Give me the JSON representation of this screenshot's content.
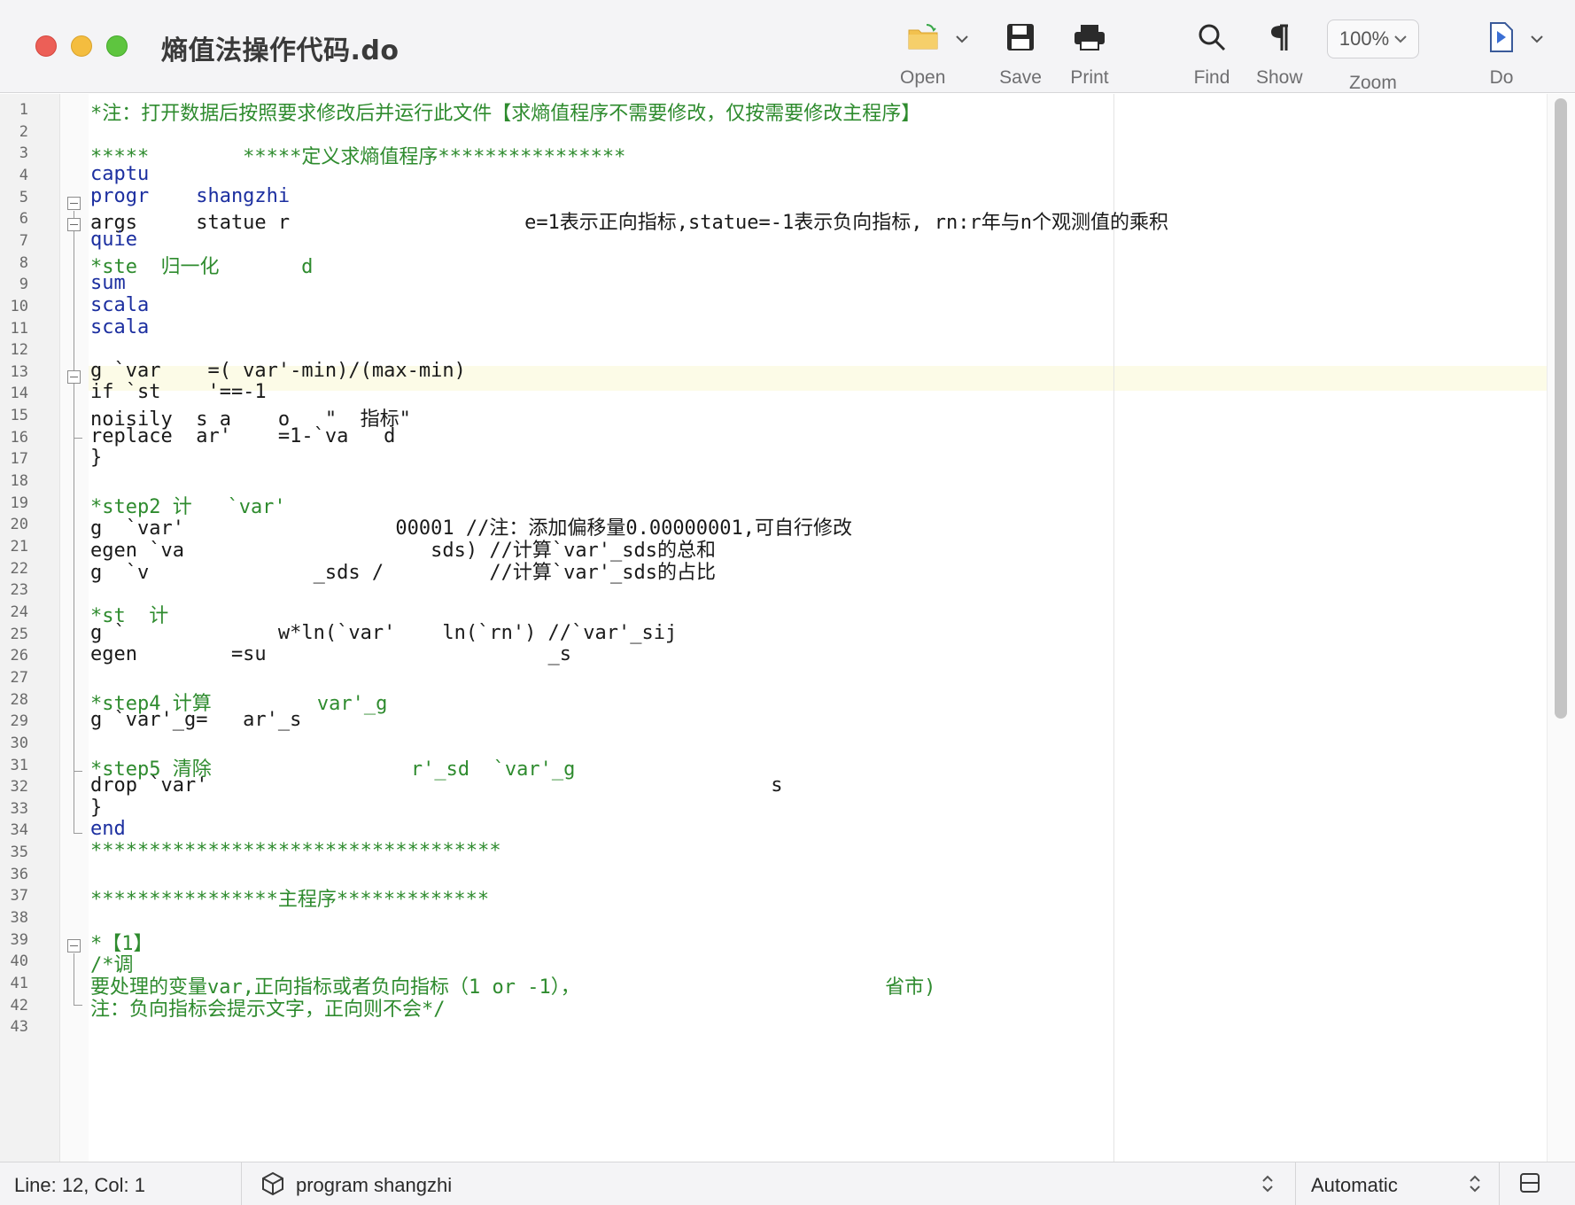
{
  "window": {
    "title": "熵值法操作代码.do"
  },
  "toolbar": {
    "open_label": "Open",
    "save_label": "Save",
    "print_label": "Print",
    "find_label": "Find",
    "show_label": "Show",
    "zoom_label": "Zoom",
    "zoom_value": "100%",
    "do_label": "Do"
  },
  "editor": {
    "current_line": 12,
    "line_numbers": [
      "1",
      "2",
      "3",
      "4",
      "5",
      "6",
      "7",
      "8",
      "9",
      "10",
      "11",
      "12",
      "13",
      "14",
      "15",
      "16",
      "17",
      "18",
      "19",
      "20",
      "21",
      "22",
      "23",
      "24",
      "25",
      "26",
      "27",
      "28",
      "29",
      "30",
      "31",
      "32",
      "33",
      "34",
      "35",
      "36",
      "37",
      "38",
      "39",
      "40",
      "41",
      "42",
      "43"
    ],
    "lines": [
      {
        "n": 1,
        "text": "*注：打开数据后按照要求修改后并运行此文件【求熵值程序不需要修改，仅按需要修改主程序】",
        "kind": "comment"
      },
      {
        "n": 3,
        "text": "*****        *****定义求熵值程序****************",
        "kind": "comment"
      },
      {
        "n": 4,
        "text": "captu",
        "kind": "kw"
      },
      {
        "n": 5,
        "text": "progr    shangzhi",
        "kind": "kw"
      },
      {
        "n": 6,
        "text": "args     statue r                    e=1表示正向指标,statue=-1表示负向指标, rn:r年与n个观测值的乘积",
        "kind": "mixed"
      },
      {
        "n": 7,
        "text": "quie",
        "kind": "kw"
      },
      {
        "n": 8,
        "text": "*ste  归一化       d",
        "kind": "comment"
      },
      {
        "n": 9,
        "text": "sum",
        "kind": "kw"
      },
      {
        "n": 10,
        "text": "scala",
        "kind": "kw"
      },
      {
        "n": 11,
        "text": "scala",
        "kind": "kw"
      },
      {
        "n": 13,
        "text": "g `var    =( var'-min)/(max-min)",
        "kind": "text"
      },
      {
        "n": 14,
        "text": "if `st    '==-1",
        "kind": "text"
      },
      {
        "n": 15,
        "text": "noisily  s a    o   \"  指标\"",
        "kind": "text"
      },
      {
        "n": 16,
        "text": "replace  ar'    =1-`va   d",
        "kind": "text"
      },
      {
        "n": 17,
        "text": "}",
        "kind": "text"
      },
      {
        "n": 19,
        "text": "*step2 计   `var'",
        "kind": "comment"
      },
      {
        "n": 20,
        "text": "g  `var'                  00001 //注：添加偏移量0.00000001,可自行修改",
        "kind": "mixed"
      },
      {
        "n": 21,
        "text": "egen `va                     sds) //计算`var'_sds的总和",
        "kind": "mixed"
      },
      {
        "n": 22,
        "text": "g  `v              _sds /         //计算`var'_sds的占比",
        "kind": "mixed"
      },
      {
        "n": 24,
        "text": "*st  计",
        "kind": "comment"
      },
      {
        "n": 25,
        "text": "g `             w*ln(`var'    ln(`rn') //`var'_sij",
        "kind": "mixed"
      },
      {
        "n": 26,
        "text": "egen        =su                        _s",
        "kind": "mixed"
      },
      {
        "n": 28,
        "text": "*step4 计算         var'_g",
        "kind": "comment"
      },
      {
        "n": 29,
        "text": "g `var'_g=   ar'_s",
        "kind": "text"
      },
      {
        "n": 31,
        "text": "*step5 清除                 r'_sd  `var'_g",
        "kind": "comment"
      },
      {
        "n": 32,
        "text": "drop `var'                                                s",
        "kind": "text"
      },
      {
        "n": 33,
        "text": "}",
        "kind": "text"
      },
      {
        "n": 34,
        "text": "end",
        "kind": "kw"
      },
      {
        "n": 35,
        "text": "***********************************",
        "kind": "comment"
      },
      {
        "n": 37,
        "text": "****************主程序*************",
        "kind": "comment"
      },
      {
        "n": 39,
        "text": "*【1】",
        "kind": "comment"
      },
      {
        "n": 40,
        "text": "/*调",
        "kind": "comment"
      },
      {
        "n": 41,
        "text": "要处理的变量var,正向指标或者负向指标（1 or -1），                          省市)",
        "kind": "comment"
      },
      {
        "n": 42,
        "text": "注：负向指标会提示文字，正向则不会*/",
        "kind": "comment"
      }
    ]
  },
  "statusbar": {
    "position": "Line: 12, Col: 1",
    "scope": "program shangzhi",
    "encoding": "Automatic"
  },
  "colors": {
    "comment": "#2e8b2e",
    "keyword": "#1c2fa0",
    "text": "#1a1a1a",
    "current_line": "#fcfbe7"
  }
}
